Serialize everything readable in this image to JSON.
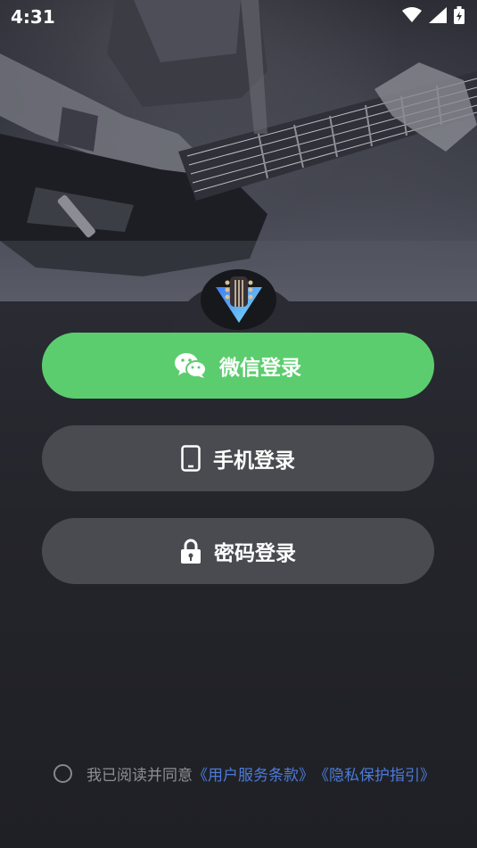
{
  "status_bar": {
    "time": "4:31"
  },
  "buttons": {
    "wechat_label": "微信登录",
    "phone_label": "手机登录",
    "password_label": "密码登录"
  },
  "agreement": {
    "text": "我已阅读并同意",
    "terms_link": "《用户服务条款》",
    "privacy_link": "《隐私保护指引》"
  },
  "colors": {
    "wechat_green": "#5ccd6e",
    "secondary_button": "#4a4b50",
    "link_blue": "#4b7bd9",
    "background": "#1f1f23"
  },
  "icons": {
    "wechat": "wechat-icon",
    "phone": "phone-icon",
    "lock": "lock-icon",
    "wifi": "wifi-icon",
    "signal": "signal-icon",
    "battery": "battery-icon"
  }
}
